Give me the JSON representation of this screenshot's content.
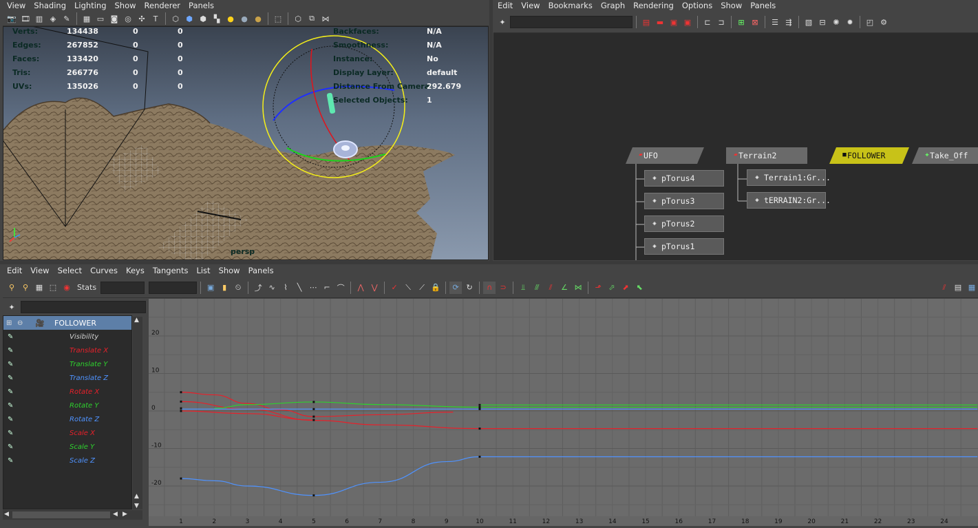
{
  "viewport_menu": [
    "View",
    "Shading",
    "Lighting",
    "Show",
    "Renderer",
    "Panels"
  ],
  "hypergraph_menu": [
    "Edit",
    "View",
    "Bookmarks",
    "Graph",
    "Rendering",
    "Options",
    "Show",
    "Panels"
  ],
  "graph_menu": [
    "Edit",
    "View",
    "Select",
    "Curves",
    "Keys",
    "Tangents",
    "List",
    "Show",
    "Panels"
  ],
  "hud": {
    "left": [
      {
        "label": "Verts:",
        "v1": "134438",
        "v2": "0",
        "v3": "0"
      },
      {
        "label": "Edges:",
        "v1": "267852",
        "v2": "0",
        "v3": "0"
      },
      {
        "label": "Faces:",
        "v1": "133420",
        "v2": "0",
        "v3": "0"
      },
      {
        "label": "Tris:",
        "v1": "266776",
        "v2": "0",
        "v3": "0"
      },
      {
        "label": "UVs:",
        "v1": "135026",
        "v2": "0",
        "v3": "0"
      }
    ],
    "right": [
      {
        "label": "Backfaces:",
        "value": "N/A"
      },
      {
        "label": "Smoothness:",
        "value": "N/A"
      },
      {
        "label": "Instance:",
        "value": "No"
      },
      {
        "label": "Display Layer:",
        "value": "default"
      },
      {
        "label": "Distance From Camera:",
        "value": "292.679"
      },
      {
        "label": "Selected Objects:",
        "value": "1"
      }
    ],
    "camera": "persp"
  },
  "hypergraph": {
    "heads": [
      "UFO",
      "Terrain2",
      "FOLLOWER",
      "Take_Off"
    ],
    "ufo_children": [
      "pTorus4",
      "pTorus3",
      "pTorus2",
      "pTorus1"
    ],
    "terrain_children": [
      "Terrain1:Gr...",
      "tERRAIN2:Gr..."
    ]
  },
  "graph_toolbar": {
    "stats_label": "Stats"
  },
  "outliner": {
    "object": "FOLLOWER",
    "channels": [
      {
        "label": "Visibility",
        "color": "#cfcfcf"
      },
      {
        "label": "Translate X",
        "color": "#e8202a"
      },
      {
        "label": "Translate Y",
        "color": "#2ed12e"
      },
      {
        "label": "Translate Z",
        "color": "#4f93ff"
      },
      {
        "label": "Rotate X",
        "color": "#e8202a"
      },
      {
        "label": "Rotate Y",
        "color": "#2ed12e"
      },
      {
        "label": "Rotate Z",
        "color": "#4f93ff"
      },
      {
        "label": "Scale X",
        "color": "#e8202a"
      },
      {
        "label": "Scale Y",
        "color": "#2ed12e"
      },
      {
        "label": "Scale Z",
        "color": "#4f93ff"
      }
    ]
  },
  "chart_data": {
    "type": "line",
    "x_ticks": [
      "1",
      "2",
      "3",
      "4",
      "5",
      "6",
      "7",
      "8",
      "9",
      "10",
      "11",
      "12",
      "13",
      "14",
      "15",
      "16",
      "17",
      "18",
      "19",
      "20",
      "21",
      "22",
      "23",
      "24"
    ],
    "y_ticks": [
      "20",
      "10",
      "0",
      "-10",
      "-20"
    ],
    "xlim": [
      0.5,
      25
    ],
    "ylim": [
      -27,
      30
    ],
    "series": [
      {
        "color": "#e8202a",
        "x": [
          1,
          2,
          3,
          4,
          5,
          7,
          9.2
        ],
        "y": [
          5,
          4.3,
          2,
          0.3,
          -1.5,
          -1,
          -0.3
        ]
      },
      {
        "color": "#e8202a",
        "x": [
          1,
          3,
          5,
          7,
          10,
          25
        ],
        "y": [
          2.5,
          0.5,
          -2.5,
          -3.7,
          -4.7,
          -4.7
        ]
      },
      {
        "color": "#e8202a",
        "x": [
          1,
          3,
          5
        ],
        "y": [
          0,
          -0.7,
          -2.4
        ]
      },
      {
        "color": "#2ed12e",
        "x": [
          2,
          3,
          5,
          7,
          10,
          25
        ],
        "y": [
          0.7,
          1.7,
          2.4,
          1.7,
          1,
          1
        ]
      },
      {
        "color": "#4f93ff",
        "x": [
          1,
          10,
          25
        ],
        "y": [
          0.5,
          0.5,
          0.5
        ]
      },
      {
        "color": "#4f93ff",
        "x": [
          1,
          2,
          3,
          5,
          7,
          9,
          10,
          25
        ],
        "y": [
          -18,
          -18.6,
          -20,
          -22.5,
          -19,
          -13.5,
          -12.2,
          -12.2
        ]
      },
      {
        "color": "#2ed12e",
        "x": [
          10,
          25
        ],
        "y": [
          1.6,
          1.6
        ]
      }
    ],
    "keys": [
      {
        "x": 1,
        "y": 5
      },
      {
        "x": 1,
        "y": 2.5
      },
      {
        "x": 1,
        "y": 0.7
      },
      {
        "x": 1,
        "y": 0
      },
      {
        "x": 1,
        "y": -18
      },
      {
        "x": 5,
        "y": 2.4
      },
      {
        "x": 5,
        "y": 0.5
      },
      {
        "x": 5,
        "y": -1.5
      },
      {
        "x": 5,
        "y": -2.4
      },
      {
        "x": 5,
        "y": -22.5
      },
      {
        "x": 10,
        "y": 1.6
      },
      {
        "x": 10,
        "y": 1
      },
      {
        "x": 10,
        "y": 0.5
      },
      {
        "x": 10,
        "y": -4.7
      },
      {
        "x": 10,
        "y": -12.2
      }
    ]
  }
}
